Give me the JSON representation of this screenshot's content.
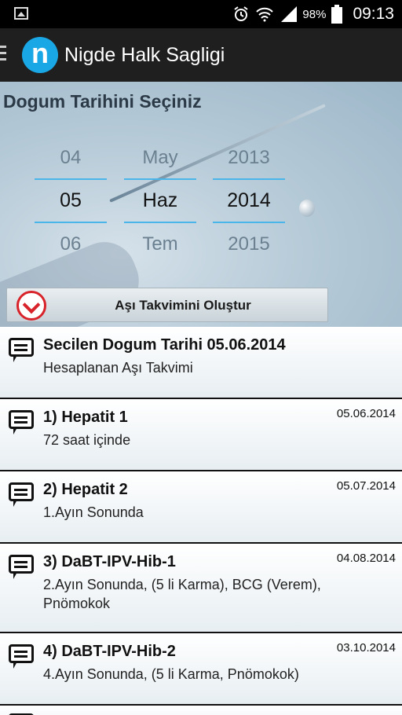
{
  "status_bar": {
    "battery_percent": "98%",
    "time": "09:13",
    "icons": [
      "image-icon",
      "alarm-icon",
      "wifi-icon",
      "signal-icon",
      "battery-icon"
    ]
  },
  "action_bar": {
    "logo_letter": "n",
    "title": "Nigde Halk Sagligi"
  },
  "header": {
    "title": "Dogum Tarihini Seçiniz"
  },
  "date_picker": {
    "day": {
      "prev": "04",
      "selected": "05",
      "next": "06"
    },
    "month": {
      "prev": "May",
      "selected": "Haz",
      "next": "Tem"
    },
    "year": {
      "prev": "2013",
      "selected": "2014",
      "next": "2015"
    }
  },
  "create_button": {
    "label": "Aşı Takvimini Oluştur"
  },
  "list": {
    "summary": {
      "title": "Secilen Dogum Tarihi 05.06.2014",
      "subtitle": "Hesaplanan Aşı Takvimi"
    },
    "items": [
      {
        "title": "1) Hepatit 1",
        "date": "05.06.2014",
        "description": "72 saat içinde"
      },
      {
        "title": "2) Hepatit 2",
        "date": "05.07.2014",
        "description": "1.Ayın Sonunda"
      },
      {
        "title": "3) DaBT-IPV-Hib-1",
        "date": "04.08.2014",
        "description": "2.Ayın Sonunda, (5 li Karma), BCG (Verem), Pnömokok"
      },
      {
        "title": "4) DaBT-IPV-Hib-2",
        "date": "03.10.2014",
        "description": "4.Ayın Sonunda,  (5 li Karma, Pnömokok)"
      }
    ]
  },
  "colors": {
    "accent": "#1aa7e6",
    "picker_line": "#49b5e8",
    "button_icon": "#d8232a"
  }
}
